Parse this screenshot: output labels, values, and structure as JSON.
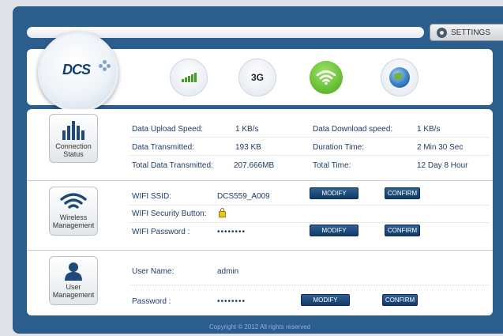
{
  "header": {
    "settings_label": "SETTINGS",
    "logo_text": "DCS",
    "status_3g": "3G"
  },
  "connection": {
    "caption_line1": "Connection",
    "caption_line2": "Status",
    "upload_label": "Data Upload Speed:",
    "upload_value": "1 KB/s",
    "download_label": "Data Download speed:",
    "download_value": "1 KB/s",
    "transmitted_label": "Data Transmitted:",
    "transmitted_value": "193 KB",
    "duration_label": "Duration Time:",
    "duration_value": "2 Min 30 Sec",
    "total_transmitted_label": "Total Data Transmitted:",
    "total_transmitted_value": "207.666MB",
    "total_time_label": "Total Time:",
    "total_time_value": "12 Day 8 Hour"
  },
  "wireless": {
    "caption_line1": "Wireless",
    "caption_line2": "Management",
    "ssid_label": "WIFI SSID:",
    "ssid_value": "DCS559_A009",
    "security_label": "WIFI Security Button:",
    "password_label": "WIFI Password :",
    "password_value": "••••••••",
    "modify_label": "MODIFY",
    "confirm_label": "CONFIRM"
  },
  "user": {
    "caption_line1": "User",
    "caption_line2": "Management",
    "username_label": "User Name:",
    "username_value": "admin",
    "password_label": "Password :",
    "password_value": "••••••••",
    "modify_label": "MODIFY",
    "confirm_label": "CONFIRM"
  },
  "footer": {
    "copyright": "Copyright © 2012 All rights reserved"
  },
  "colors": {
    "frame_blue": "#2c5e8d",
    "button_blue": "#1a4475",
    "text_blue": "#1f3d66",
    "signal_green": "#4c9a2a",
    "wifi_green": "#6ccf2f"
  },
  "icons": {
    "settings": "gear-icon",
    "signal": "signal-strength-icon",
    "wifi": "wifi-icon",
    "internet": "globe-icon",
    "connection": "bar-chart-icon",
    "wireless": "wifi-icon",
    "user": "user-icon",
    "lock": "lock-icon"
  }
}
